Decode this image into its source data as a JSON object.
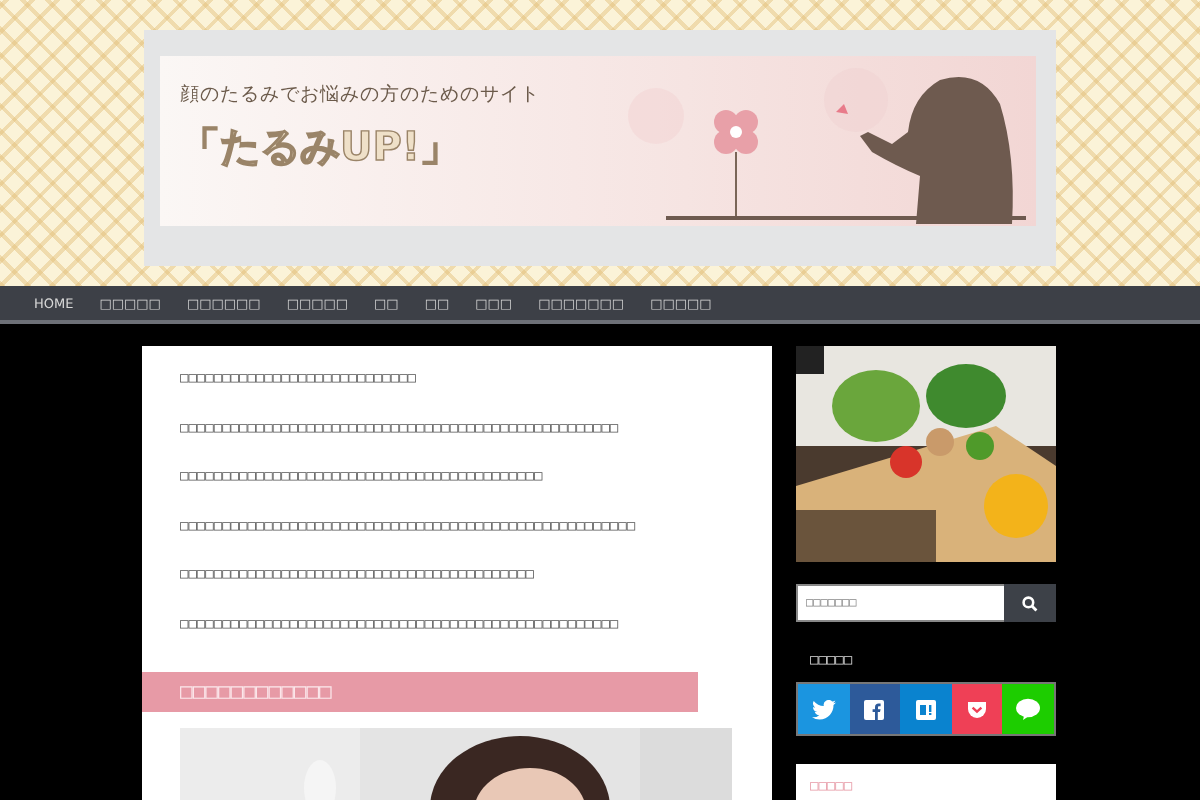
{
  "header": {
    "tagline": "顔のたるみでお悩みの方のためのサイト",
    "title": "「たるみUP!」"
  },
  "nav": [
    "HOME",
    "□□□□□",
    "□□□□□□",
    "□□□□□",
    "□□",
    "□□",
    "□□□",
    "□□□□□□□",
    "□□□□□"
  ],
  "article": {
    "paragraphs": [
      "□□□□□□□□□□□□□□□□□□□□□□□□□□□□",
      "□□□□□□□□□□□□□□□□□□□□□□□□□□□□□□□□□□□□□□□□□□□□□□□□□□□□",
      "□□□□□□□□□□□□□□□□□□□□□□□□□□□□□□□□□□□□□□□□□□□",
      "□□□□□□□□□□□□□□□□□□□□□□□□□□□□□□□□□□□□□□□□□□□□□□□□□□□□□□",
      "□□□□□□□□□□□□□□□□□□□□□□□□□□□□□□□□□□□□□□□□□□",
      "□□□□□□□□□□□□□□□□□□□□□□□□□□□□□□□□□□□□□□□□□□□□□□□□□□□□"
    ],
    "heading": "□□□□□□□□□□□□"
  },
  "sidebar": {
    "search": {
      "placeholder": "□□□□□□□"
    },
    "share_title": "□□□□□",
    "share_buttons": [
      {
        "kind": "twitter",
        "color": "#1b95e0"
      },
      {
        "kind": "facebook",
        "color": "#2d5a9a"
      },
      {
        "kind": "hatena",
        "color": "#0a83cf"
      },
      {
        "kind": "pocket",
        "color": "#ef4056"
      },
      {
        "kind": "line",
        "color": "#1dcd00"
      }
    ],
    "widget_title": "□□□□□"
  }
}
